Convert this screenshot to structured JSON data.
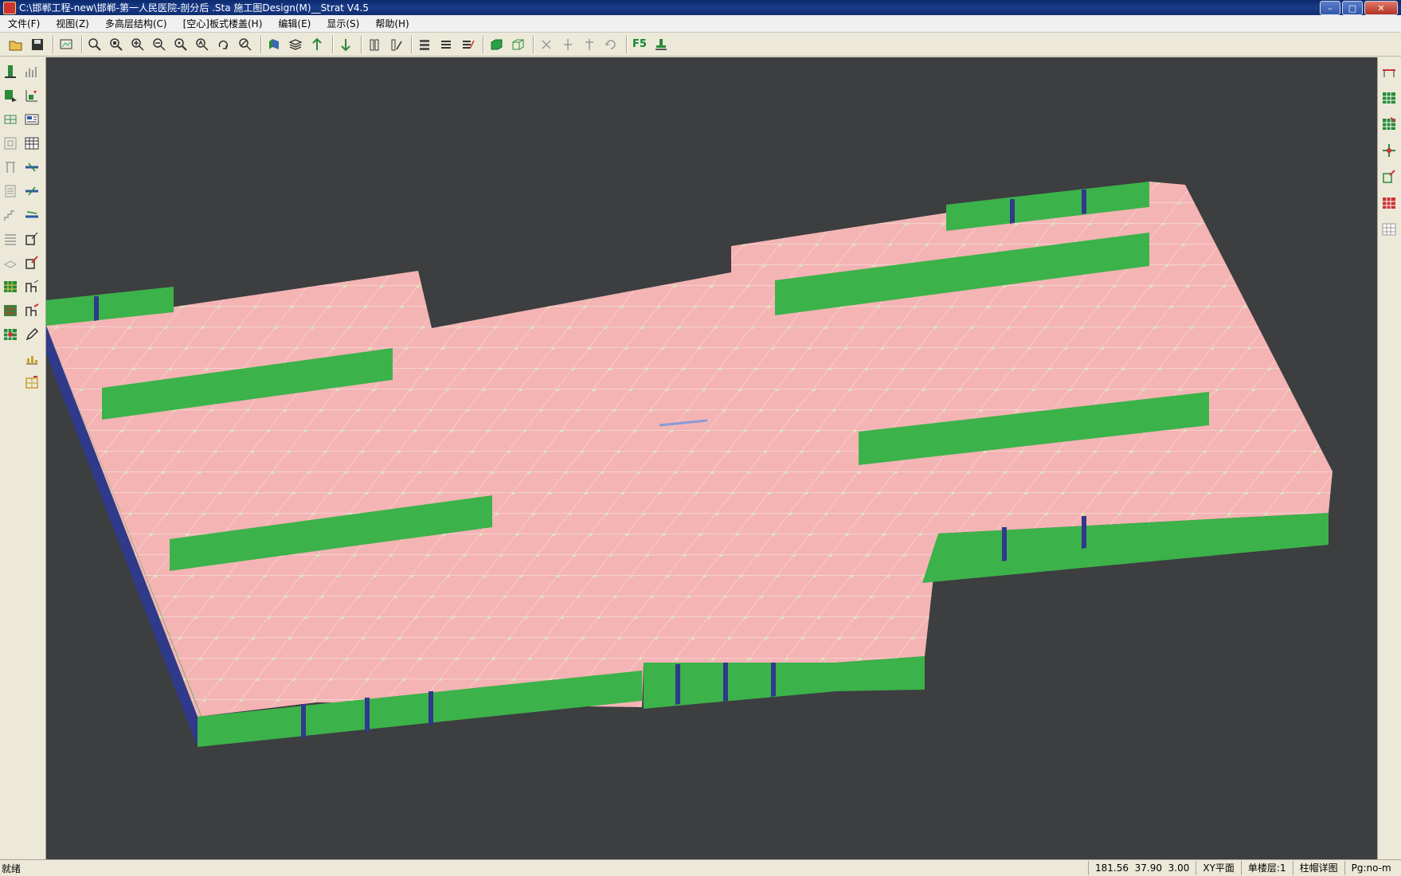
{
  "window": {
    "title": "C:\\邯郸工程-new\\邯郸-第一人民医院-剖分后 .Sta  施工图Design(M)__Strat V4.5",
    "minimize": "–",
    "maximize": "□",
    "close": "✕"
  },
  "menu": [
    {
      "label": "文件(F)"
    },
    {
      "label": "视图(Z)"
    },
    {
      "label": "多高层结构(C)"
    },
    {
      "label": "[空心]板式楼盖(H)"
    },
    {
      "label": "编辑(E)"
    },
    {
      "label": "显示(S)"
    },
    {
      "label": "帮助(H)"
    }
  ],
  "toolbar": {
    "f5_label": "F5",
    "icons": [
      "open-icon",
      "save-icon",
      "view-icon",
      "zoom-window-icon",
      "zoom-all-icon",
      "zoom-in-icon",
      "zoom-out-icon",
      "zoom-real-icon",
      "zoom-previous-icon",
      "rotate-icon",
      "zoom-extent-icon",
      "floor-3d-icon",
      "layers-icon",
      "up-arrow-icon",
      "down-arrow-icon",
      "column-icon",
      "column-edit-icon",
      "slab-stack-icon",
      "slab-stack-2-icon",
      "slab-edit-icon",
      "box-3d-icon",
      "box-wire-icon",
      "scissors-icon",
      "beam-split-icon",
      "beam-join-icon",
      "undo-icon",
      "f5-refresh",
      "stamp-icon"
    ]
  },
  "left_tools": {
    "col1": [
      "column-green-icon",
      "beam-add-icon",
      "grid-icon",
      "frame-icon",
      "wall-icon",
      "panel-icon",
      "stair-icon",
      "table-icon",
      "slab-icon",
      "rebar-grid-icon",
      "rebar-grid-2-icon",
      "rebar-grid-3-icon"
    ],
    "col2": [
      "chart-icon",
      "chart-up-icon",
      "report-icon",
      "calc-icon",
      "beam-section-icon",
      "beam-section-2-icon",
      "beam-section-3-icon",
      "detail-icon",
      "detail-edit-icon",
      "layout-icon",
      "layout-edit-icon",
      "pencil-icon",
      "stack-bars-icon",
      "stack-bars-edit-icon"
    ]
  },
  "right_tools": [
    "beam-red-icon",
    "grid-green-icon",
    "grid-red-icon",
    "node-icon",
    "column-grid-icon",
    "grid-cross-icon",
    "grid-plain-icon"
  ],
  "status": {
    "message": "就绪",
    "x": "181.56",
    "y": "37.90",
    "z": "3.00",
    "plane": "XY平面",
    "floor": "单楼层:1",
    "detail": "柱帽详图",
    "pg": "Pg:no-m"
  },
  "colors": {
    "viewport_bg": "#3c3e40",
    "slab": "#f4b4b4",
    "wall": "#3cb24a",
    "wall_dark": "#2f3a8a",
    "column_cap": "#d8e8b8"
  }
}
